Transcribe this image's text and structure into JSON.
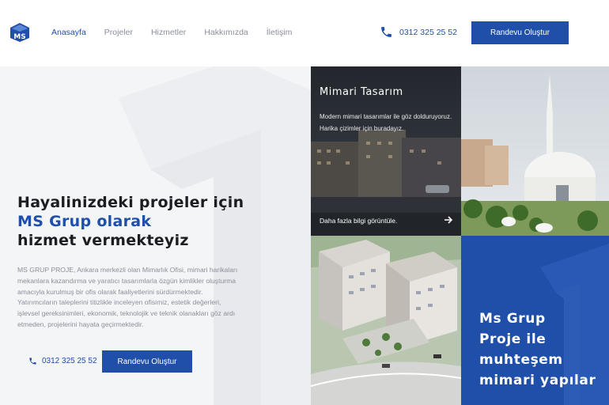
{
  "brand": {
    "logo_icon": "ms-logo-icon",
    "accent": "#1f4fa8"
  },
  "nav": {
    "items": [
      {
        "label": "Anasayfa",
        "active": true
      },
      {
        "label": "Projeler"
      },
      {
        "label": "Hizmetler"
      },
      {
        "label": "Hakkımızda"
      },
      {
        "label": "İletişim"
      }
    ]
  },
  "header": {
    "phone": "0312 325 25 52",
    "cta": "Randevu Oluştur"
  },
  "hero": {
    "title_line1": "Hayalinizdeki projeler için",
    "title_line2": "MS Grup olarak",
    "title_line3": "hizmet vermekteyiz",
    "text": "MS GRUP PROJE, Ankara merkezli olan Mimarlık Ofisi, mimari harikaları mekanlara kazandırma ve yaratıcı tasarımlarla özgün kimlikler oluşturma amacıyla kurulmuş bir ofis olarak faaliyetlerini sürdürmektedir. Yatırımcıların taleplerini titizlikle inceleyen ofisimiz, estetik değerleri, işlevsel gereksinimleri, ekonomik, teknolojik ve teknik olanakları göz ardı etmeden, projelerini hayata geçirmektedir.",
    "phone": "0312 325 25 52",
    "cta": "Randevu Oluştur"
  },
  "tiles": {
    "mimari": {
      "title": "Mimari Tasarım",
      "desc": "Modern mimari tasarımlar ile göz dolduruyoruz. Harika çizimler için buradayız.",
      "more": "Daha fazla bilgi görüntüle."
    },
    "banner": {
      "line1": "Ms Grup",
      "line2": "Proje ile",
      "line3": "muhteşem",
      "line4": "mimari yapılar"
    }
  }
}
